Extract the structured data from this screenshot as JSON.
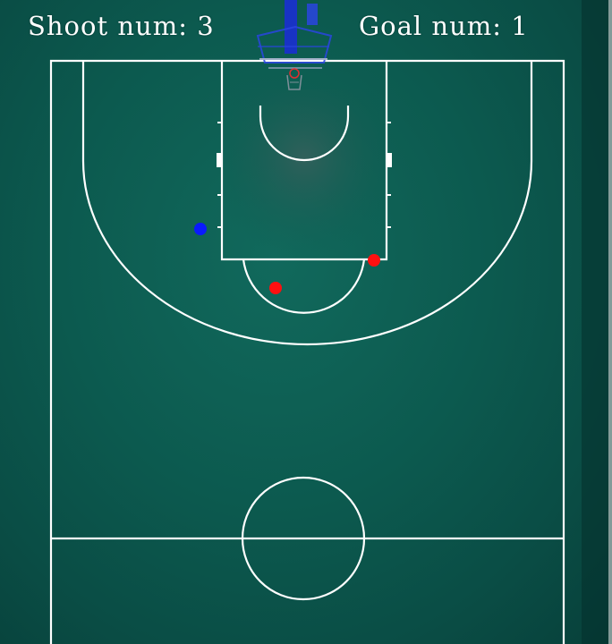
{
  "hud": {
    "shoot_label": "Shoot num:",
    "shoot_value": "3",
    "goal_label": "Goal num:",
    "goal_value": "1"
  },
  "markers": [
    {
      "name": "shot-marker-blue",
      "color": "#0a1aff"
    },
    {
      "name": "shot-marker-red-1",
      "color": "#ff1010"
    },
    {
      "name": "shot-marker-red-2",
      "color": "#ff1010"
    }
  ],
  "colors": {
    "court": "#0c5a4f",
    "line": "#ffffff",
    "backboard": "#1a2fd0"
  }
}
